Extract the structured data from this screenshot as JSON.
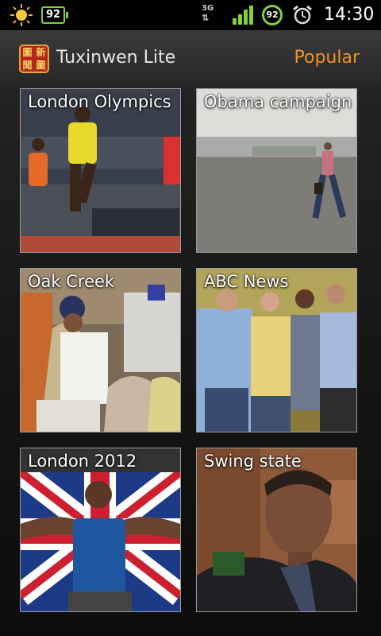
{
  "status_bar": {
    "notification_badge": "92",
    "network": "3G",
    "battery_level": "92",
    "time": "14:30",
    "icons": [
      "weather-sun-icon",
      "battery-widget-icon",
      "network-3g-icon",
      "signal-strength-icon",
      "battery-icon",
      "alarm-clock-icon"
    ]
  },
  "header": {
    "app_title": "Tuxinwen Lite",
    "popular_label": "Popular",
    "logo_icon": "app-logo-icon"
  },
  "tiles": [
    {
      "caption": "London Olympics"
    },
    {
      "caption": "Obama campaign"
    },
    {
      "caption": "Oak Creek"
    },
    {
      "caption": "ABC News"
    },
    {
      "caption": "London 2012"
    },
    {
      "caption": "Swing state"
    }
  ],
  "colors": {
    "accent": "#f0922b",
    "status_green": "#7fd23b",
    "tile_border": "#9a9a9a"
  }
}
